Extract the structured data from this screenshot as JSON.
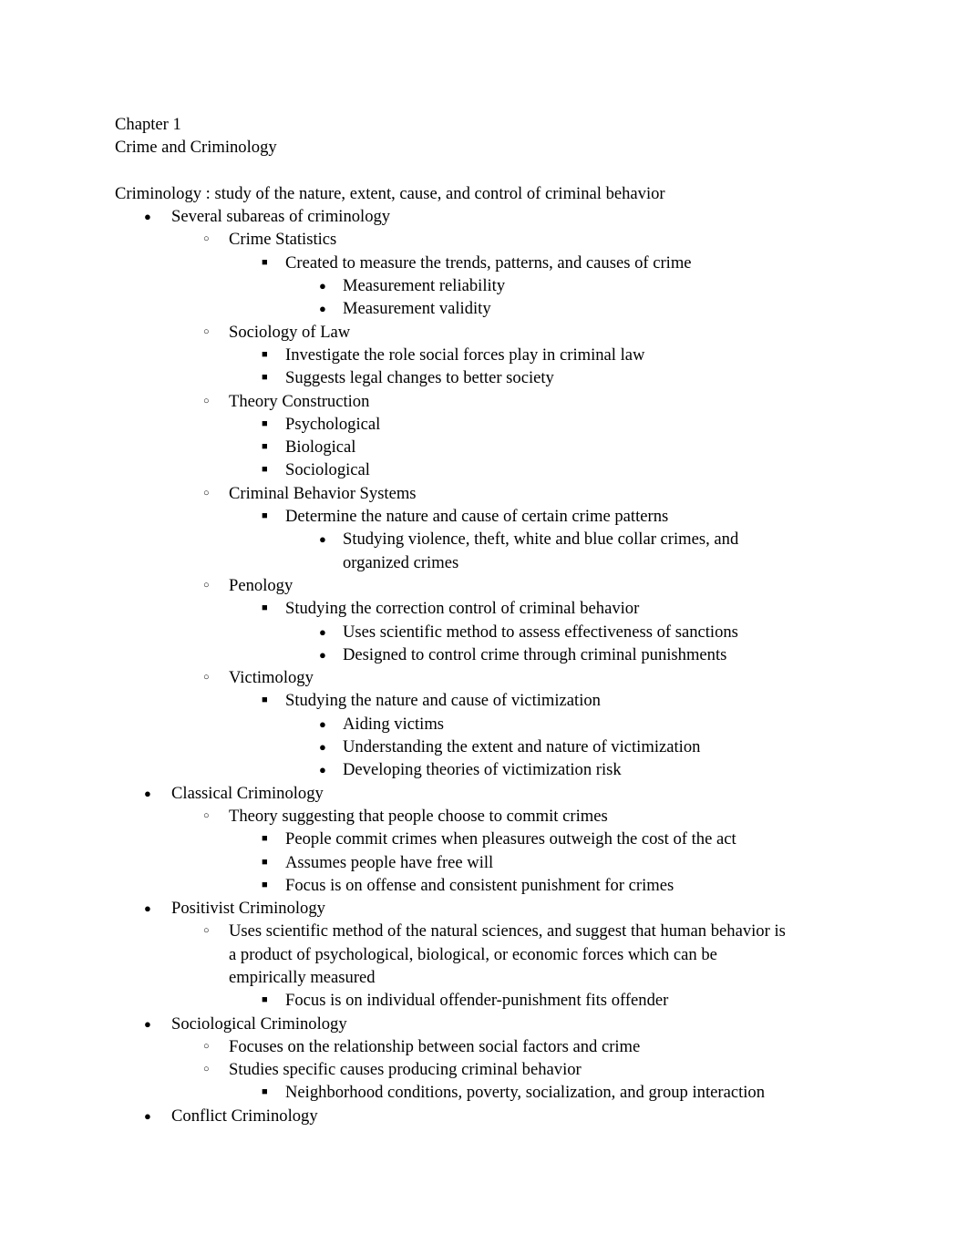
{
  "document": {
    "heading_lines": [
      "Chapter 1",
      "Crime and Criminology"
    ],
    "blank_separator": "",
    "intro": "Criminology : study of the nature, extent, cause, and control of criminal behavior",
    "bullets": {
      "level1_glyph": "●",
      "level2_glyph": "○",
      "level3_glyph": "■",
      "level4_glyph": "●"
    },
    "outline": [
      {
        "level": 1,
        "text": "Several subareas of criminology"
      },
      {
        "level": 2,
        "text": "Crime Statistics"
      },
      {
        "level": 3,
        "text": "Created to measure the trends, patterns, and causes of crime"
      },
      {
        "level": 4,
        "text": "Measurement reliability"
      },
      {
        "level": 4,
        "text": "Measurement validity"
      },
      {
        "level": 2,
        "text": "Sociology of Law"
      },
      {
        "level": 3,
        "text": "Investigate the role social forces play in criminal law"
      },
      {
        "level": 3,
        "text": "Suggests legal changes to better society"
      },
      {
        "level": 2,
        "text": "Theory Construction"
      },
      {
        "level": 3,
        "text": "Psychological"
      },
      {
        "level": 3,
        "text": "Biological"
      },
      {
        "level": 3,
        "text": "Sociological"
      },
      {
        "level": 2,
        "text": "Criminal Behavior Systems"
      },
      {
        "level": 3,
        "text": "Determine the nature and cause of certain crime patterns"
      },
      {
        "level": 4,
        "text": "Studying violence, theft, white and blue collar crimes, and organized crimes"
      },
      {
        "level": 2,
        "text": "Penology"
      },
      {
        "level": 3,
        "text": "Studying the correction control of criminal behavior"
      },
      {
        "level": 4,
        "text": "Uses scientific method to assess effectiveness of sanctions"
      },
      {
        "level": 4,
        "text": "Designed to control crime through criminal punishments"
      },
      {
        "level": 2,
        "text": "Victimology"
      },
      {
        "level": 3,
        "text": "Studying the nature and cause of victimization"
      },
      {
        "level": 4,
        "text": "Aiding victims"
      },
      {
        "level": 4,
        "text": "Understanding the extent and nature of victimization"
      },
      {
        "level": 4,
        "text": "Developing theories of victimization risk"
      },
      {
        "level": 1,
        "text": "Classical Criminology"
      },
      {
        "level": 2,
        "text": "Theory suggesting that people choose to commit crimes"
      },
      {
        "level": 3,
        "text": "People commit crimes when pleasures outweigh the cost of the act"
      },
      {
        "level": 3,
        "text": "Assumes people have free will"
      },
      {
        "level": 3,
        "text": "Focus is on offense and consistent punishment for crimes"
      },
      {
        "level": 1,
        "text": "Positivist Criminology"
      },
      {
        "level": 2,
        "text": "Uses scientific method of the natural sciences, and suggest that human behavior is a product of psychological, biological, or economic forces which can be empirically measured"
      },
      {
        "level": 3,
        "text": "Focus is on individual offender-punishment fits offender"
      },
      {
        "level": 1,
        "text": "Sociological Criminology"
      },
      {
        "level": 2,
        "text": "Focuses on the relationship between social factors and crime"
      },
      {
        "level": 2,
        "text": "Studies specific causes producing criminal behavior"
      },
      {
        "level": 3,
        "text": "Neighborhood conditions, poverty, socialization, and group interaction"
      },
      {
        "level": 1,
        "text": "Conflict Criminology"
      }
    ]
  }
}
